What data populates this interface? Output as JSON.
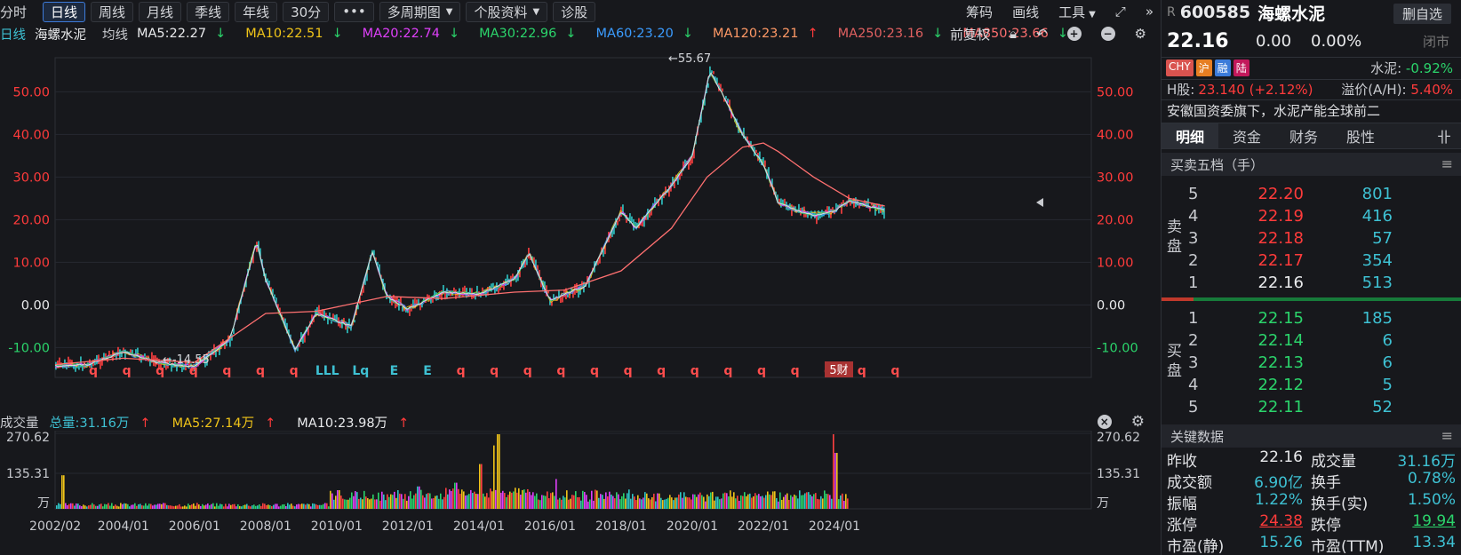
{
  "toolbar": {
    "periods": [
      "分时",
      "日线",
      "周线",
      "月线",
      "季线",
      "年线",
      "30分"
    ],
    "active_period": "日线",
    "more": "•••",
    "multi_period": "多周期图",
    "stock_info": "个股资料",
    "diagnose": "诊股",
    "chips": "筹码",
    "draw_line": "画线",
    "tools": "工具",
    "expand": "⤢",
    "collapse": "»"
  },
  "ma_bar": {
    "type_label": "日线",
    "stock_name": "海螺水泥",
    "avg_label": "均线",
    "items": [
      {
        "text": "MA5:22.27",
        "arrow": "↓",
        "color": "#e9eaec",
        "arrow_color": "#2bd46b"
      },
      {
        "text": "MA10:22.51",
        "arrow": "↓",
        "color": "#f0c419",
        "arrow_color": "#2bd46b"
      },
      {
        "text": "MA20:22.74",
        "arrow": "↓",
        "color": "#e040fb",
        "arrow_color": "#2bd46b"
      },
      {
        "text": "MA30:22.96",
        "arrow": "↓",
        "color": "#2bd46b",
        "arrow_color": "#2bd46b"
      },
      {
        "text": "MA60:23.20",
        "arrow": "↓",
        "color": "#3b9cff",
        "arrow_color": "#2bd46b"
      },
      {
        "text": "MA120:23.21",
        "arrow": "↑",
        "color": "#ff9966",
        "arrow_color": "#ff3b3b"
      },
      {
        "text": "MA250:23.16",
        "arrow": "↓",
        "color": "#e06060",
        "arrow_color": "#2bd46b"
      },
      {
        "text": "MA850:23.66",
        "arrow": "↓",
        "color": "#ff7070",
        "arrow_color": "#2bd46b"
      }
    ],
    "adjust": "前复权"
  },
  "volume_bar": {
    "label": "成交量",
    "total": "总量:31.16万",
    "total_arrow": "↑",
    "ma5": "MA5:27.14万",
    "ma5_arrow": "↑",
    "ma10": "MA10:23.98万",
    "ma10_arrow": "↑"
  },
  "chart_data": [
    {
      "type": "line",
      "title": "海螺水泥 日线",
      "y_ticks": [
        "50.00",
        "40.00",
        "30.00",
        "20.00",
        "10.00",
        "0.00",
        "-10.00"
      ],
      "y_tick_values": [
        50,
        40,
        30,
        20,
        10,
        0,
        -10
      ],
      "ylim": [
        -17,
        58
      ],
      "max_label": "←55.67",
      "min_label": "←-14.55",
      "series": [
        {
          "name": "收盘",
          "x": [
            "2002/02",
            "2003/01",
            "2004/01",
            "2005/01",
            "2006/01",
            "2007/01",
            "2007/10",
            "2008/01",
            "2008/11",
            "2009/06",
            "2010/06",
            "2011/01",
            "2011/06",
            "2012/01",
            "2013/01",
            "2014/01",
            "2015/01",
            "2015/06",
            "2016/01",
            "2017/01",
            "2018/01",
            "2018/06",
            "2019/01",
            "2019/06",
            "2020/01",
            "2020/07",
            "2021/01",
            "2021/06",
            "2022/01",
            "2022/06",
            "2023/01",
            "2023/06",
            "2024/01",
            "2024/06",
            "2025/01",
            "2025/06"
          ],
          "y": [
            -14.3,
            -14.0,
            -11.0,
            -13.5,
            -14.5,
            -8.0,
            15.0,
            6.0,
            -10.5,
            -2.0,
            -5.0,
            12.5,
            2.0,
            -1.0,
            3.0,
            2.5,
            6.0,
            12.0,
            1.0,
            4.5,
            22.0,
            18.0,
            24.0,
            28.0,
            35.0,
            55.0,
            47.0,
            40.0,
            33.0,
            24.0,
            22.0,
            21.0,
            22.0,
            24.5,
            23.0,
            22.2
          ]
        },
        {
          "name": "MA250",
          "x": [
            "2002/02",
            "2004/01",
            "2006/01",
            "2008/01",
            "2009/06",
            "2011/06",
            "2013/01",
            "2015/01",
            "2016/06",
            "2018/01",
            "2019/06",
            "2020/06",
            "2021/06",
            "2022/01",
            "2022/06",
            "2023/06",
            "2024/06",
            "2025/06"
          ],
          "y": [
            -14.0,
            -12.5,
            -13.5,
            -2.0,
            -1.5,
            2.0,
            1.5,
            3.0,
            3.5,
            8.0,
            18.0,
            30.0,
            37.0,
            38.0,
            36.0,
            30.0,
            25.0,
            23.2
          ]
        }
      ],
      "x_labels": [
        "2002/02",
        "2004/01",
        "2006/01",
        "2008/01",
        "2010/01",
        "2012/01",
        "2014/01",
        "2016/01",
        "2018/01",
        "2020/01",
        "2022/01",
        "2024/01"
      ],
      "markers": [
        "q",
        "q",
        "q",
        "q",
        "q",
        "q",
        "q",
        "LLL",
        "Lq",
        "E",
        "E",
        "q",
        "q",
        "q",
        "q",
        "q",
        "q",
        "q",
        "q",
        "q",
        "q",
        "q",
        "q",
        "q",
        "q"
      ],
      "report_label": "5财"
    },
    {
      "type": "bar",
      "title": "成交量",
      "y_ticks": [
        "270.62",
        "135.31",
        "万"
      ],
      "ylim": [
        0,
        270.62
      ]
    }
  ],
  "right_panel": {
    "code_prefix": "R",
    "code": "600585",
    "name": "海螺水泥",
    "remove_btn": "删自选",
    "price": "22.16",
    "change": "0.00",
    "change_pct": "0.00%",
    "status": "闭市",
    "badges": [
      "CHY",
      "沪",
      "融",
      "陆"
    ],
    "badge_colors": [
      "#d9534f",
      "#e67e22",
      "#3b7bd9",
      "#c2185b"
    ],
    "sector": "水泥:",
    "sector_pct": "-0.92%",
    "h_label": "H股:",
    "h_value": "23.140 (+2.12%)",
    "premium_label": "溢价(A/H):",
    "premium_value": "5.40%",
    "desc": "安徽国资委旗下，水泥产能全球前二",
    "tabs": [
      "明细",
      "资金",
      "财务",
      "股性"
    ],
    "active_tab": "明细",
    "tab_icon": "卝",
    "ob_title": "买卖五档（手）",
    "sell_label": [
      "卖",
      "盘"
    ],
    "buy_label": [
      "买",
      "盘"
    ],
    "asks": [
      {
        "lvl": "5",
        "price": "22.20",
        "vol": "801"
      },
      {
        "lvl": "4",
        "price": "22.19",
        "vol": "416"
      },
      {
        "lvl": "3",
        "price": "22.18",
        "vol": "57"
      },
      {
        "lvl": "2",
        "price": "22.17",
        "vol": "354"
      },
      {
        "lvl": "1",
        "price": "22.16",
        "vol": "513"
      }
    ],
    "bids": [
      {
        "lvl": "1",
        "price": "22.15",
        "vol": "185"
      },
      {
        "lvl": "2",
        "price": "22.14",
        "vol": "6"
      },
      {
        "lvl": "3",
        "price": "22.13",
        "vol": "6"
      },
      {
        "lvl": "4",
        "price": "22.12",
        "vol": "5"
      },
      {
        "lvl": "5",
        "price": "22.11",
        "vol": "52"
      }
    ],
    "kd_title": "关键数据",
    "kd": [
      {
        "l": "昨收",
        "v": "22.16",
        "vc": "white",
        "l2": "成交量",
        "v2": "31.16万",
        "v2c": "cyan"
      },
      {
        "l": "成交额",
        "v": "6.90亿",
        "vc": "cyan",
        "l2": "换手",
        "v2": "0.78%",
        "v2c": "cyan"
      },
      {
        "l": "振幅",
        "v": "1.22%",
        "vc": "cyan",
        "l2": "换手(实)",
        "v2": "1.50%",
        "v2c": "cyan"
      },
      {
        "l": "涨停",
        "v": "24.38",
        "vc": "red",
        "l2": "跌停",
        "v2": "19.94",
        "v2c": "green"
      },
      {
        "l": "市盈(静)",
        "v": "15.26",
        "vc": "cyan",
        "l2": "市盈(TTM)",
        "v2": "13.34",
        "v2c": "cyan"
      }
    ]
  }
}
